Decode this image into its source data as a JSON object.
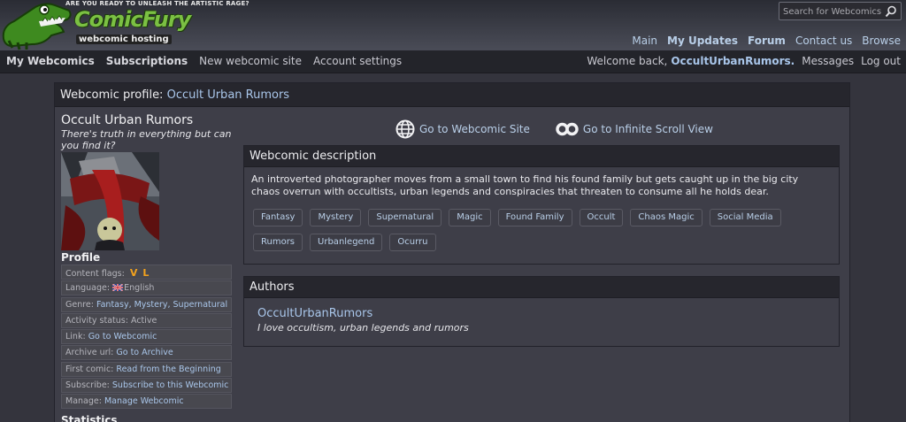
{
  "header": {
    "logo_tagline": "ARE YOU READY TO UNLEASH THE ARTISTIC RAGE?",
    "logo_word": "ComicFury",
    "logo_sub": "webcomic hosting",
    "search_placeholder": "Search for Webcomics",
    "nav": [
      "Main",
      "My Updates",
      "Forum",
      "Contact us",
      "Browse"
    ]
  },
  "subnav": {
    "left": [
      "My Webcomics",
      "Subscriptions",
      "New webcomic site",
      "Account settings"
    ],
    "welcome": "Welcome back,",
    "username": "OccultUrbanRumors.",
    "messages": "Messages",
    "logout": "Log out"
  },
  "page": {
    "heading_label": "Webcomic profile:",
    "heading_comic": "Occult Urban Rumors"
  },
  "comic": {
    "title": "Occult Urban Rumors",
    "tagline": "There's truth in everything but can you find it?",
    "profile_heading": "Profile",
    "stats_heading": "Statistics"
  },
  "profile_rows": [
    {
      "label": "Content flags:",
      "value": ""
    },
    {
      "label": "Language:",
      "value": "English"
    },
    {
      "label": "Genre:",
      "value": "Fantasy, Mystery, Supernatural"
    },
    {
      "label": "Activity status:",
      "value": "Active"
    },
    {
      "label": "Link:",
      "value": "Go to Webcomic"
    },
    {
      "label": "Archive url:",
      "value": "Go to Archive"
    },
    {
      "label": "First comic:",
      "value": "Read from the Beginning"
    },
    {
      "label": "Subscribe:",
      "value": "Subscribe to this Webcomic"
    },
    {
      "label": "Manage:",
      "value": "Manage Webcomic"
    }
  ],
  "content_flags": [
    "V",
    "L"
  ],
  "links": {
    "site": "Go to Webcomic Site",
    "scroll": "Go to Infinite Scroll View"
  },
  "description": {
    "heading": "Webcomic description",
    "text": "An introverted photographer moves from a small town to find his found family but gets caught up in the big city chaos overrun with occultists, urban legends and conspiracies that threaten to consume all he holds dear.",
    "tags": [
      "Fantasy",
      "Mystery",
      "Supernatural",
      "Magic",
      "Found Family",
      "Occult",
      "Chaos Magic",
      "Social Media",
      "Rumors",
      "Urbanlegend",
      "Ocurru"
    ]
  },
  "authors": {
    "heading": "Authors",
    "name": "OccultUrbanRumors",
    "bio": "I love occultism, urban legends and rumors"
  },
  "colors": {
    "accent_link": "#a9c6ea",
    "flag": "#f3a21d",
    "logo_green": "#7bc043"
  }
}
